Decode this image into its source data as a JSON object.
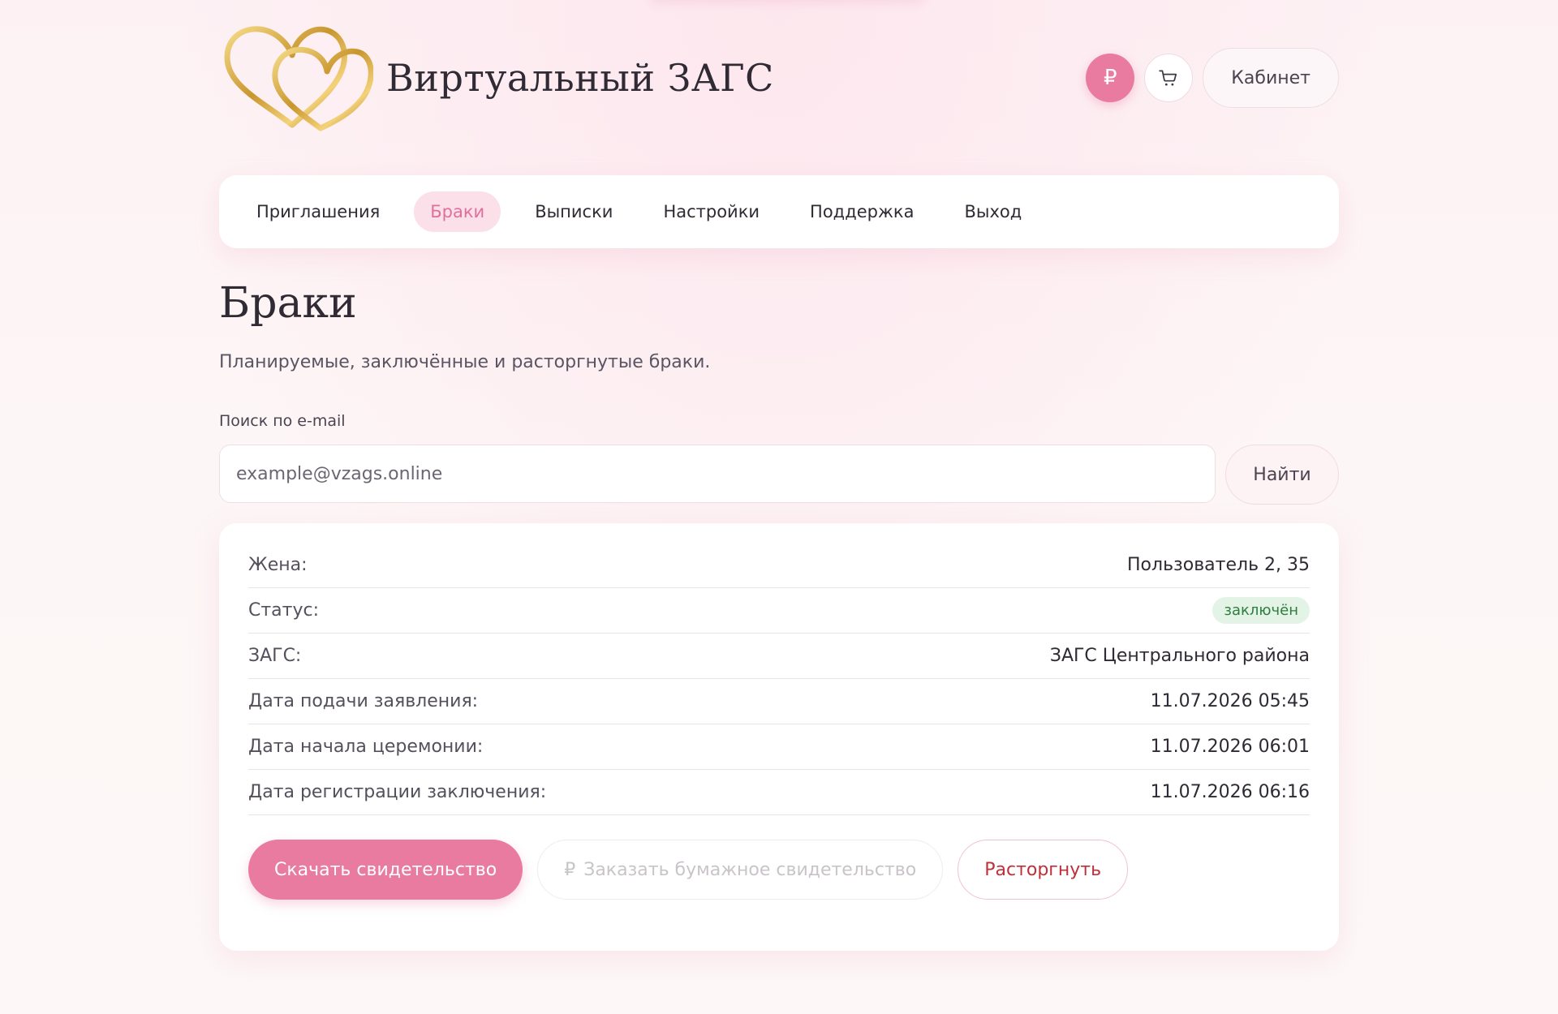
{
  "app": {
    "title": "Виртуальный ЗАГС",
    "accent_color": "#e97ba0"
  },
  "header": {
    "logo_icon": "golden-hearts-logo",
    "ruble_icon": "₽",
    "cart_icon": "cart-icon",
    "cabinet_label": "Кабинет"
  },
  "nav": {
    "items": [
      {
        "label": "Приглашения",
        "active": false
      },
      {
        "label": "Браки",
        "active": true
      },
      {
        "label": "Выписки",
        "active": false
      },
      {
        "label": "Настройки",
        "active": false
      },
      {
        "label": "Поддержка",
        "active": false
      },
      {
        "label": "Выход",
        "active": false
      }
    ]
  },
  "page": {
    "title": "Браки",
    "subtitle": "Планируемые, заключённые и расторгнутые браки."
  },
  "search": {
    "label": "Поиск по e-mail",
    "placeholder": "example@vzags.online",
    "value": "",
    "button_label": "Найти"
  },
  "marriage": {
    "rows": [
      {
        "label": "Жена:",
        "value": "Пользователь 2, 35"
      },
      {
        "label": "Статус:",
        "value": "заключён",
        "status_color": "#2e7d3e"
      },
      {
        "label": "ЗАГС:",
        "value": "ЗАГС Центрального района"
      },
      {
        "label": "Дата подачи заявления:",
        "value": "11.07.2026 05:45"
      },
      {
        "label": "Дата начала церемонии:",
        "value": "11.07.2026 06:01"
      },
      {
        "label": "Дата регистрации заключения:",
        "value": "11.07.2026 06:16"
      }
    ],
    "actions": {
      "download_label": "Скачать свидетельство",
      "order_paper_icon": "₽",
      "order_paper_label": "Заказать бумажное свидетельство",
      "dissolve_label": "Расторгнуть"
    }
  }
}
